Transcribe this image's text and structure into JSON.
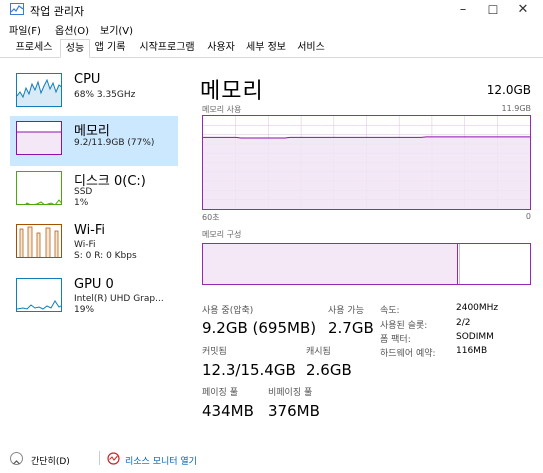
{
  "window": {
    "title": "작업 관리자",
    "minimize": "–",
    "maximize": "☐",
    "close": "✕"
  },
  "menu": [
    "파일(F)",
    "옵션(O)",
    "보기(V)"
  ],
  "tabs": [
    "프로세스",
    "성능",
    "앱 기록",
    "시작프로그램",
    "사용자",
    "세부 정보",
    "서비스"
  ],
  "active_tab": "성능",
  "sidebar": {
    "items": [
      {
        "name": "CPU",
        "sub1": "68% 3.35GHz",
        "sub2": "",
        "sub3": "",
        "color": "#117dbb"
      },
      {
        "name": "메모리",
        "sub1": "9.2/11.9GB (77%)",
        "sub2": "",
        "sub3": "",
        "color": "#8b12ae"
      },
      {
        "name": "디스크 0(C:)",
        "sub1": "SSD",
        "sub2": "1%",
        "sub3": "",
        "color": "#4da60c"
      },
      {
        "name": "Wi-Fi",
        "sub1": "Wi-Fi",
        "sub2": "S: 0 R: 0 Kbps",
        "sub3": "",
        "color": "#a74f01"
      },
      {
        "name": "GPU 0",
        "sub1": "Intel(R) UHD Grap...",
        "sub2": "19%",
        "sub3": "",
        "color": "#117dbb"
      }
    ]
  },
  "main": {
    "title": "메모리",
    "total": "12.0GB",
    "graph_label": "메모리 사용",
    "graph_max": "11.9GB",
    "time_label": "60초",
    "time_end": "0",
    "composition_label": "메모리 구성",
    "usage_fraction": 0.77,
    "composition_used_fraction": 0.78
  },
  "stats": {
    "in_use_label": "사용 중(압축)",
    "in_use_value": "9.2GB (695MB)",
    "available_label": "사용 가능",
    "available_value": "2.7GB",
    "committed_label": "커밋됨",
    "committed_value": "12.3/15.4GB",
    "cached_label": "캐시됨",
    "cached_value": "2.6GB",
    "paged_label": "페이징 풀",
    "paged_value": "434MB",
    "nonpaged_label": "비페이징 풀",
    "nonpaged_value": "376MB",
    "speed_label": "속도:",
    "speed_value": "2400MHz",
    "slots_label": "사용된 슬롯:",
    "slots_value": "2/2",
    "form_label": "폼 팩터:",
    "form_value": "SODIMM",
    "reserved_label": "하드웨어 예약:",
    "reserved_value": "116MB"
  },
  "bottom": {
    "fewer_details": "간단히(D)",
    "resource_monitor": "리소스 모니터 열기"
  }
}
